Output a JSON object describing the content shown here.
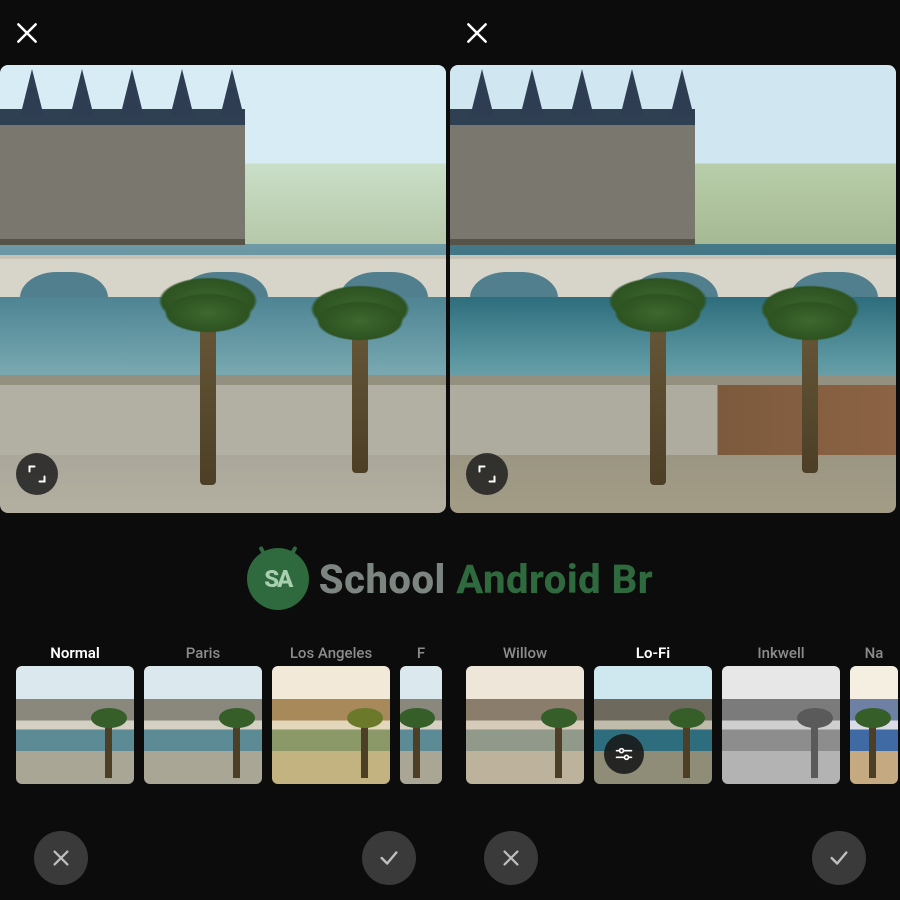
{
  "watermark": {
    "brand_left": "School",
    "brand_right": "Android Br",
    "badge_text": "SA"
  },
  "left": {
    "filters": [
      {
        "label": "Normal",
        "style": "normal",
        "active": true
      },
      {
        "label": "Paris",
        "style": "normal",
        "active": false
      },
      {
        "label": "Los Angeles",
        "style": "la",
        "active": false
      },
      {
        "label": "F",
        "style": "normal",
        "active": false,
        "partial": true
      }
    ]
  },
  "right": {
    "filters": [
      {
        "label": "Willow",
        "style": "sepia",
        "active": false
      },
      {
        "label": "Lo-Fi",
        "style": "lofi",
        "active": true,
        "adjust": true
      },
      {
        "label": "Inkwell",
        "style": "bw",
        "active": false
      },
      {
        "label": "Na",
        "style": "nash",
        "active": false,
        "partial_r": true
      }
    ]
  }
}
